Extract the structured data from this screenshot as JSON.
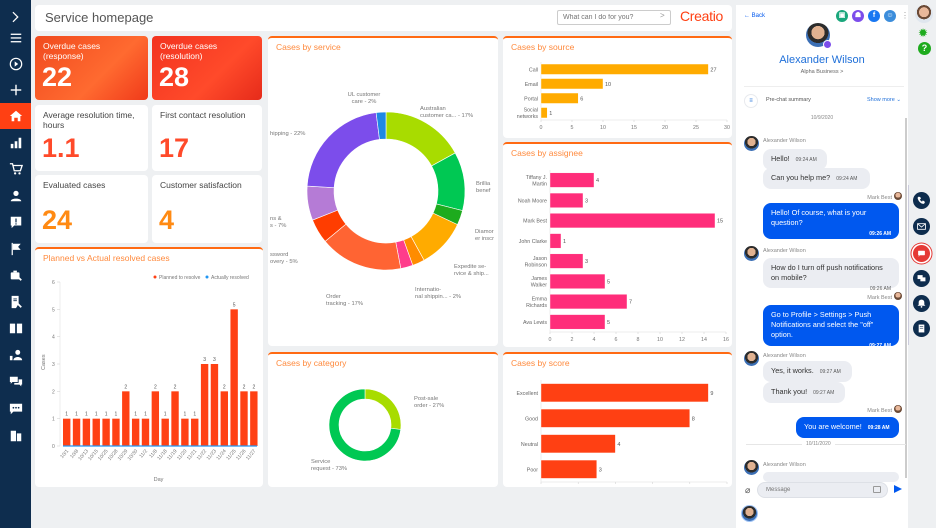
{
  "header": {
    "title": "Service homepage",
    "search_placeholder": "What can I do for you?",
    "search_go": ">",
    "logo": "Creatio"
  },
  "sidebar": {
    "items": [
      {
        "name": "expand",
        "icon": "chevron-right-icon"
      },
      {
        "name": "menu",
        "icon": "hamburger-icon"
      },
      {
        "name": "processes",
        "icon": "play-icon"
      },
      {
        "name": "add",
        "icon": "plus-icon"
      },
      {
        "name": "home",
        "icon": "home-icon",
        "active": true
      },
      {
        "name": "dashboards",
        "icon": "bar-chart-icon"
      },
      {
        "name": "orders",
        "icon": "cart-icon"
      },
      {
        "name": "contacts",
        "icon": "person-icon"
      },
      {
        "name": "cases",
        "icon": "alert-icon"
      },
      {
        "name": "milestones",
        "icon": "flag-icon"
      },
      {
        "name": "service-catalog",
        "icon": "briefcase-wrench-icon"
      },
      {
        "name": "service-agreements",
        "icon": "doc-wrench-icon"
      },
      {
        "name": "knowledge-base",
        "icon": "book-icon"
      },
      {
        "name": "agents",
        "icon": "user-group-icon"
      },
      {
        "name": "chats",
        "icon": "chat-bubbles-icon"
      },
      {
        "name": "messages",
        "icon": "message-dots-icon"
      },
      {
        "name": "configuration",
        "icon": "buildings-icon"
      }
    ],
    "accent": "#ff4013",
    "background": "#0e2d4e"
  },
  "kpis": [
    {
      "title": "Overdue cases (response)",
      "value": "22",
      "style": "hot"
    },
    {
      "title": "Overdue cases (resolution)",
      "value": "28",
      "style": "hot2"
    },
    {
      "title": "Average resolution time, hours",
      "value": "1.1",
      "style": "red"
    },
    {
      "title": "First contact resolution",
      "value": "17",
      "style": "red"
    },
    {
      "title": "Evaluated cases",
      "value": "24",
      "style": "orange"
    },
    {
      "title": "Customer satisfaction",
      "value": "4",
      "style": "orange"
    }
  ],
  "chart_data": [
    {
      "id": "planned-vs-actual",
      "type": "bar",
      "title": "Planned vs Actual resolved cases",
      "xlabel": "Day",
      "ylabel": "Cases",
      "ylim": [
        0,
        6
      ],
      "yticks": [
        0,
        1,
        2,
        3,
        4,
        5,
        6
      ],
      "legend": "top-right",
      "categories": [
        "10/1",
        "10/8",
        "10/13",
        "10/15",
        "10/25",
        "10/28",
        "10/29",
        "10/30",
        "11/2",
        "11/8",
        "11/18",
        "11/19",
        "11/20",
        "11/21",
        "11/22",
        "11/23",
        "11/24",
        "11/25",
        "11/26",
        "11/27"
      ],
      "series": [
        {
          "name": "Planned to resolve",
          "color": "#ff4013",
          "values": [
            1,
            1,
            1,
            1,
            1,
            1,
            2,
            1,
            1,
            2,
            1,
            2,
            1,
            1,
            3,
            3,
            2,
            5,
            2,
            2
          ]
        },
        {
          "name": "Actually resolved",
          "color": "#2196f3",
          "values": [
            0,
            0,
            0,
            0,
            0,
            0,
            0,
            0,
            0,
            0,
            0,
            0,
            0,
            0,
            0,
            0,
            0,
            0,
            0,
            0
          ]
        }
      ]
    },
    {
      "id": "cases-by-service",
      "type": "pie",
      "title": "Cases by service",
      "slices": [
        {
          "label": "Australian customer ca... - 17%",
          "value": 17,
          "color": "#a8dc00"
        },
        {
          "label": "Brilliant benef...",
          "value": 12,
          "color": "#00c853"
        },
        {
          "label": "Diamond insur...",
          "value": 3,
          "color": "#1eab1e"
        },
        {
          "label": "Expedite service & ship...",
          "value": 10,
          "color": "#ffab00"
        },
        {
          "label": "International shippin... - 2%",
          "value": 2.5,
          "color": "#ff8c00"
        },
        {
          "label": "",
          "value": 2.5,
          "color": "#ff3d8b"
        },
        {
          "label": "Order tracking - 17%",
          "value": 17,
          "color": "#ff6433"
        },
        {
          "label": "...ssword recovery - 5%",
          "value": 5,
          "color": "#ff3d00"
        },
        {
          "label": "...ns & ...s - 7%",
          "value": 7,
          "color": "#b57bd6"
        },
        {
          "label": "...hipping - 22%",
          "value": 22,
          "color": "#7c4deb"
        },
        {
          "label": "UL customer care - 2%",
          "value": 2,
          "color": "#1e88e5"
        }
      ]
    },
    {
      "id": "cases-by-source",
      "type": "bar",
      "orientation": "horizontal",
      "title": "Cases by source",
      "categories": [
        "Call",
        "Email",
        "Portal",
        "Social networks"
      ],
      "values": [
        27,
        10,
        6,
        1
      ],
      "color": "#ffab00",
      "xlim": [
        0,
        30
      ],
      "xticks": [
        0,
        5,
        10,
        15,
        20,
        25,
        30
      ]
    },
    {
      "id": "cases-by-assignee",
      "type": "bar",
      "orientation": "horizontal",
      "title": "Cases by assignee",
      "categories": [
        "Tiffany J. Martin",
        "Noah Moore",
        "Mark Best",
        "John Clarke",
        "Jason Robinson",
        "James Walker",
        "Emma Richards",
        "Ava Lewis"
      ],
      "values": [
        4,
        3,
        15,
        1,
        3,
        5,
        7,
        5
      ],
      "color": "#ff2d7a",
      "xlim": [
        0,
        16
      ],
      "xticks": [
        0,
        2,
        4,
        6,
        8,
        10,
        12,
        14,
        16
      ]
    },
    {
      "id": "cases-by-category",
      "type": "pie",
      "title": "Cases by category",
      "slices": [
        {
          "label": "Post-sale order - 27%",
          "value": 27,
          "color": "#a8dc00"
        },
        {
          "label": "Service request - 73%",
          "value": 73,
          "color": "#00c853"
        }
      ]
    },
    {
      "id": "cases-by-score",
      "type": "bar",
      "orientation": "horizontal",
      "title": "Cases by score",
      "categories": [
        "Excellent",
        "Good",
        "Neutral",
        "Poor"
      ],
      "values": [
        9,
        8,
        4,
        3
      ],
      "color": "#ff4013",
      "xlim": [
        0,
        10
      ],
      "xticks": [
        0,
        2,
        4,
        6,
        8,
        10
      ]
    }
  ],
  "chat": {
    "back_label": "← Back",
    "contact_name": "Alexander Wilson",
    "contact_company": "Alpha Business >",
    "channel_icons": [
      "chat-icon",
      "contacts-icon",
      "facebook-icon",
      "user-icon"
    ],
    "prechat_label": "Pre-chat summary",
    "show_more": "Show more ⌄",
    "date1": "10/9/2020",
    "date2": "10/11/2020",
    "messages": [
      {
        "author": "Alexander Wilson",
        "dir": "in",
        "text": "Hello!",
        "time": "09:24 AM"
      },
      {
        "author": "",
        "dir": "in",
        "text": "Can you help me?",
        "time": "09:24 AM"
      },
      {
        "author": "Mark Best",
        "dir": "out",
        "text": "Hello! Of course, what is your question?",
        "time": "09:26 AM"
      },
      {
        "author": "Alexander Wilson",
        "dir": "in",
        "text": "How do I turn off push notifications on mobile?",
        "time": "09:26 AM"
      },
      {
        "author": "Mark Best",
        "dir": "out",
        "text": "Go to Profile > Settings > Push Notifications and select the \"off\" option.",
        "time": "09:27 AM"
      },
      {
        "author": "Alexander Wilson",
        "dir": "in",
        "text": "Yes, it works.",
        "time": "09:27 AM"
      },
      {
        "author": "",
        "dir": "in",
        "text": "Thank you!",
        "time": "09:27 AM"
      },
      {
        "author": "Mark Best",
        "dir": "out",
        "text": "You are welcome!",
        "time": "09:28 AM"
      },
      {
        "author": "Alexander Wilson",
        "dir": "in",
        "text": "",
        "time": ""
      }
    ],
    "message_placeholder": "Message"
  },
  "rightbar": {
    "buttons": [
      "phone-icon",
      "email-icon",
      "chat-icon",
      "chats-icon",
      "bell-icon",
      "tasks-icon"
    ]
  }
}
